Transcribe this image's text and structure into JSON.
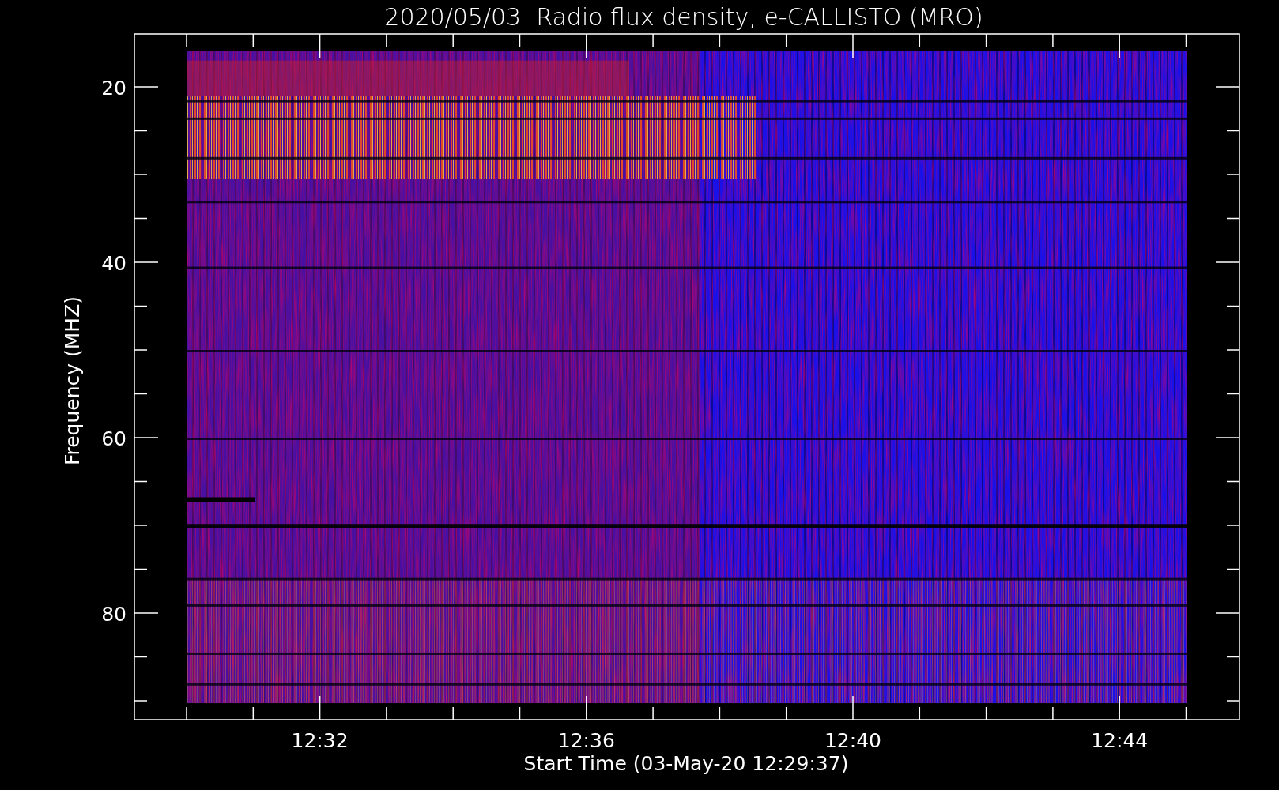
{
  "plot": {
    "title": "2020/05/03  Radio flux density, e-CALLISTO (MRO)",
    "ylabel": "Frequency (MHZ)",
    "xlabel": "Start Time (03-May-20 12:29:37)",
    "yticks": [
      "20",
      "40",
      "60",
      "80"
    ],
    "xticks": [
      "12:32",
      "12:36",
      "12:40",
      "12:44"
    ]
  }
}
